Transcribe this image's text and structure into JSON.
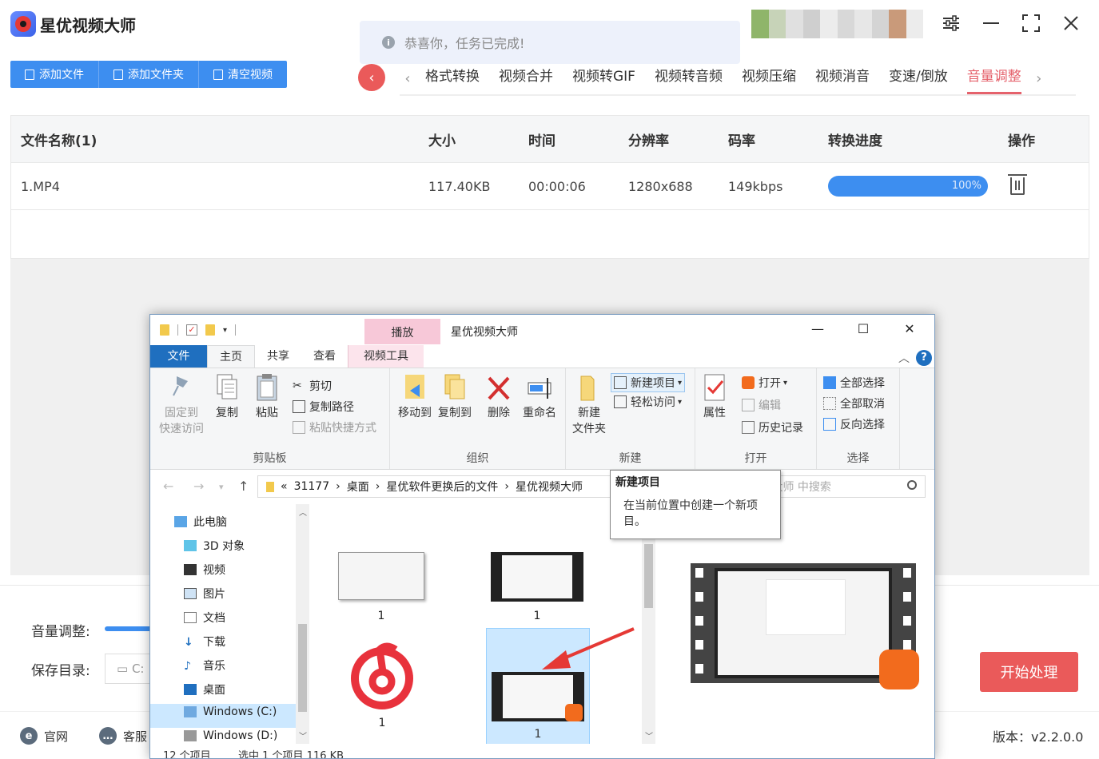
{
  "app": {
    "title": "星优视频大师",
    "toast": "恭喜你，任务已完成!",
    "toolbar": {
      "add_file": "添加文件",
      "add_folder": "添加文件夹",
      "clear": "清空视频"
    },
    "tabs": [
      "格式转换",
      "视频合并",
      "视频转GIF",
      "视频转音频",
      "视频压缩",
      "视频消音",
      "变速/倒放",
      "音量调整"
    ],
    "active_tab": "音量调整",
    "table": {
      "headers": {
        "name": "文件名称(1)",
        "size": "大小",
        "time": "时间",
        "resolution": "分辨率",
        "bitrate": "码率",
        "progress": "转换进度",
        "action": "操作"
      },
      "rows": [
        {
          "name": "1.MP4",
          "size": "117.40KB",
          "time": "00:00:06",
          "resolution": "1280x688",
          "bitrate": "149kbps",
          "progress": 1.0,
          "progress_label": "100%"
        }
      ]
    },
    "bottom": {
      "volume_label": "音量调整:",
      "save_label": "保存目录:",
      "save_value": "C:",
      "start": "开始处理"
    },
    "footer": {
      "website": "官网",
      "service": "客服",
      "version": "版本：v2.2.0.0"
    },
    "colors": {
      "accent_blue": "#3d8ef0",
      "accent_red": "#ea5a5a",
      "active_tab": "#e5626c"
    }
  },
  "explorer": {
    "title": "星优视频大师",
    "context_tab": "播放",
    "tabs": {
      "file": "文件",
      "home": "主页",
      "share": "共享",
      "view": "查看",
      "video_tools": "视频工具"
    },
    "ribbon": {
      "pin": "固定到\n快速访问",
      "pin_1": "固定到",
      "pin_2": "快速访问",
      "copy": "复制",
      "paste": "粘贴",
      "cut": "剪切",
      "copy_path": "复制路径",
      "paste_shortcut": "粘贴快捷方式",
      "clipboard": "剪贴板",
      "move_to": "移动到",
      "copy_to": "复制到",
      "delete": "删除",
      "rename": "重命名",
      "organize": "组织",
      "new_folder_1": "新建",
      "new_folder_2": "文件夹",
      "new_item": "新建项目",
      "easy_access": "轻松访问",
      "new": "新建",
      "properties": "属性",
      "open": "打开",
      "edit": "编辑",
      "history": "历史记录",
      "open_group": "打开",
      "select_all": "全部选择",
      "select_none": "全部取消",
      "invert": "反向选择",
      "select_group": "选择"
    },
    "address": {
      "root": "31177",
      "p1": "桌面",
      "p2": "星优软件更换后的文件",
      "p3": "星优视频大师"
    },
    "search_placeholder": "在 星优视频大师 中搜索",
    "tooltip": {
      "title": "新建项目",
      "body": "在当前位置中创建一个新项目。"
    },
    "nav": [
      "此电脑",
      "3D 对象",
      "视频",
      "图片",
      "文档",
      "下载",
      "音乐",
      "桌面",
      "Windows (C:)",
      "Windows (D:)"
    ],
    "files": [
      "1",
      "1",
      "1",
      "1"
    ],
    "status": {
      "count": "12 个项目",
      "selected": "选中 1 个项目  116 KB"
    }
  }
}
